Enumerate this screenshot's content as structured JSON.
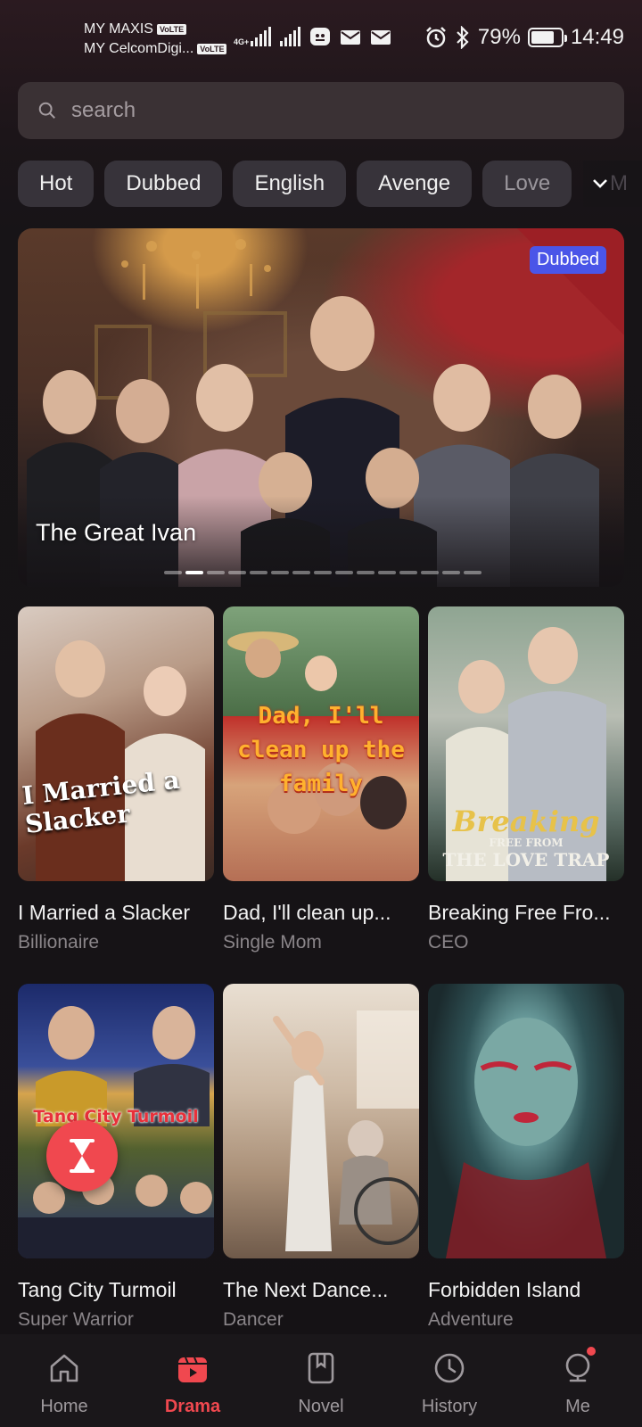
{
  "status_bar": {
    "carrier1": "MY MAXIS",
    "carrier2": "MY CelcomDigi...",
    "volte": "VoLTE",
    "net_type": "4G+",
    "battery": "79%",
    "battery_level": 0.79,
    "time": "14:49"
  },
  "search": {
    "placeholder": "search"
  },
  "chips": [
    "Hot",
    "Dubbed",
    "English",
    "Avenge",
    "Love"
  ],
  "chips_more_label": "M",
  "banner": {
    "badge": "Dubbed",
    "title": "The Great Ivan",
    "dot_count": 15,
    "active_dot": 1
  },
  "cards": [
    {
      "title": "I Married a Slacker",
      "genre": "Billionaire",
      "poster_text": "I Married a Slacker"
    },
    {
      "title": "Dad, I'll clean up...",
      "genre": "Single Mom",
      "poster_text": "Dad, I'll clean up the family"
    },
    {
      "title": "Breaking Free Fro...",
      "genre": "CEO",
      "poster_text_1": "Breaking",
      "poster_text_2": "FREE FROM",
      "poster_text_3": "THE LOVE TRAP"
    },
    {
      "title": "Tang City Turmoil",
      "genre": "Super Warrior",
      "poster_text": "Tang City Turmoil"
    },
    {
      "title": "The Next Dance...",
      "genre": "Dancer"
    },
    {
      "title": "Forbidden Island",
      "genre": "Adventure"
    }
  ],
  "nav": [
    {
      "label": "Home",
      "icon": "home-icon",
      "active": false
    },
    {
      "label": "Drama",
      "icon": "clapperboard-icon",
      "active": true
    },
    {
      "label": "Novel",
      "icon": "book-icon",
      "active": false
    },
    {
      "label": "History",
      "icon": "clock-icon",
      "active": false
    },
    {
      "label": "Me",
      "icon": "profile-icon",
      "active": false
    }
  ],
  "colors": {
    "accent": "#f0484f",
    "badge": "#4a55e8",
    "background": "#171417"
  }
}
